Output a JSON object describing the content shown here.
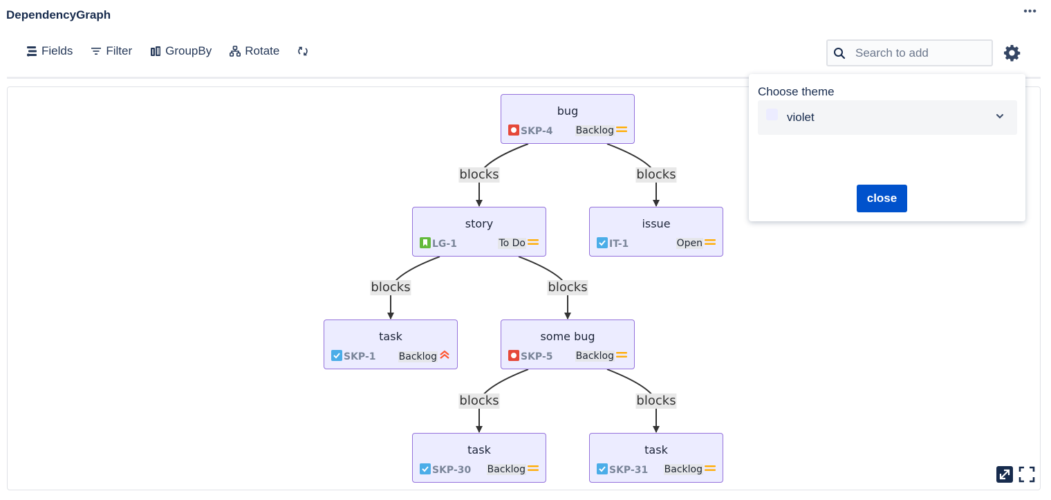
{
  "app": {
    "title": "DependencyGraph",
    "more_label": "•••"
  },
  "toolbar": {
    "fields_label": "Fields",
    "filter_label": "Filter",
    "groupby_label": "GroupBy",
    "rotate_label": "Rotate",
    "refresh_icon": "refresh-icon"
  },
  "search": {
    "placeholder": "Search to add",
    "value": ""
  },
  "theme_popup": {
    "title": "Choose theme",
    "selected": "violet",
    "swatch_color": "#ececff",
    "close_label": "close"
  },
  "colors": {
    "node_fill": "#ececff",
    "node_border": "#9370db",
    "accent": "#0052cc",
    "bug": "#e5493a",
    "story": "#63ba3c",
    "task": "#4bade8",
    "priority_medium": "#ffab00",
    "priority_high": "#ff5630"
  },
  "graph": {
    "nodes": [
      {
        "id": "n1",
        "title": "bug",
        "key": "SKP-4",
        "type": "bug",
        "status": "Backlog",
        "priority": "medium"
      },
      {
        "id": "n2",
        "title": "story",
        "key": "LG-1",
        "type": "story",
        "status": "To Do",
        "priority": "medium"
      },
      {
        "id": "n3",
        "title": "issue",
        "key": "IT-1",
        "type": "task",
        "status": "Open",
        "priority": "medium"
      },
      {
        "id": "n4",
        "title": "task",
        "key": "SKP-1",
        "type": "task",
        "status": "Backlog",
        "priority": "high"
      },
      {
        "id": "n5",
        "title": "some bug",
        "key": "SKP-5",
        "type": "bug",
        "status": "Backlog",
        "priority": "medium"
      },
      {
        "id": "n6",
        "title": "task",
        "key": "SKP-30",
        "type": "task",
        "status": "Backlog",
        "priority": "medium"
      },
      {
        "id": "n7",
        "title": "task",
        "key": "SKP-31",
        "type": "task",
        "status": "Backlog",
        "priority": "medium"
      }
    ],
    "edges": [
      {
        "from": "n1",
        "to": "n2",
        "label": "blocks"
      },
      {
        "from": "n1",
        "to": "n3",
        "label": "blocks"
      },
      {
        "from": "n2",
        "to": "n4",
        "label": "blocks"
      },
      {
        "from": "n2",
        "to": "n5",
        "label": "blocks"
      },
      {
        "from": "n5",
        "to": "n6",
        "label": "blocks"
      },
      {
        "from": "n5",
        "to": "n7",
        "label": "blocks"
      }
    ]
  }
}
